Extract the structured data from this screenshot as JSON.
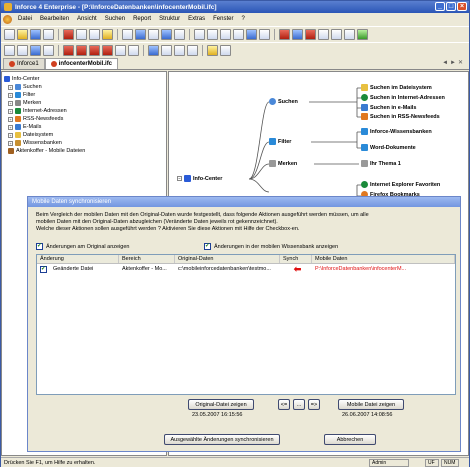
{
  "window": {
    "title": "Inforce 4 Enterprise - [P:\\InforceDatenbanken\\infocenterMobil.ifc]"
  },
  "menu": [
    "Datei",
    "Bearbeiten",
    "Ansicht",
    "Suchen",
    "Report",
    "Struktur",
    "Extras",
    "Fenster",
    "?"
  ],
  "tabs": [
    {
      "label": "Inforce1"
    },
    {
      "label": "infocenterMobil.ifc"
    }
  ],
  "tree": [
    {
      "label": "Info-Center",
      "icon": "info-icon",
      "color": "#2a5bd7",
      "level": 0,
      "pm": ""
    },
    {
      "label": "Suchen",
      "icon": "search-icon",
      "color": "#4a88d8",
      "level": 1,
      "pm": "+"
    },
    {
      "label": "Filter",
      "icon": "filter-icon",
      "color": "#2a8ad8",
      "level": 1,
      "pm": "+"
    },
    {
      "label": "Merken",
      "icon": "pencil-icon",
      "color": "#888888",
      "level": 1,
      "pm": "+"
    },
    {
      "label": "Internet-Adressen",
      "icon": "globe-icon",
      "color": "#1a8a3a",
      "level": 1,
      "pm": "+"
    },
    {
      "label": "RSS-Newsfeeds",
      "icon": "rss-icon",
      "color": "#e07820",
      "level": 1,
      "pm": "+"
    },
    {
      "label": "E-Mails",
      "icon": "mail-icon",
      "color": "#3a7ad0",
      "level": 1,
      "pm": "+"
    },
    {
      "label": "Dateisystem",
      "icon": "folder-icon",
      "color": "#e8c040",
      "level": 1,
      "pm": "+"
    },
    {
      "label": "Wissensbanken",
      "icon": "database-icon",
      "color": "#c89030",
      "level": 1,
      "pm": "+"
    },
    {
      "label": "Aktenkoffer - Mobile Dateien",
      "icon": "briefcase-icon",
      "color": "#a06020",
      "level": 1,
      "pm": ""
    }
  ],
  "map": {
    "root": "Info-Center",
    "suchen": "Suchen",
    "suchen_children": [
      "Suchen im Dateisystem",
      "Suchen in Internet-Adressen",
      "Suchen in e-Mails",
      "Suchen in RSS-Newsfeeds"
    ],
    "filter": "Filter",
    "filter_children": [
      "Inforce-Wissensbanken",
      "Word-Dokumente"
    ],
    "merken": "Merken",
    "merken_children": [
      "Ihr Thema 1"
    ],
    "more_children": [
      "Internet Explorer Favoriten",
      "Firefox Bookmarks"
    ]
  },
  "dialog": {
    "title": "Mobile Daten synchronisieren",
    "text1": "Beim Vergleich der mobilen Daten mit den Original-Daten wurde festgestellt, dass folgende Aktionen ausgeführt werden müssen, um alle",
    "text2": "mobilen Daten mit den Original-Daten abzugleichen (Veränderte Daten jeweils rot gekennzeichnet).",
    "text3": "Welche dieser Aktionen sollen ausgeführt werden ? Aktivieren Sie diese Aktionen mit Hilfe der Checkbox-en.",
    "check1": "Änderungen am Original anzeigen",
    "check2": "Änderungen in der mobilen Wissensbank anzeigen",
    "columns": [
      "Änderung",
      "Bereich",
      "Original-Daten",
      "Synch",
      "Mobile Daten"
    ],
    "row": {
      "aenderung": "Geänderte Datei",
      "bereich": "Aktenkoffer - Mo...",
      "original": "c:\\mobileinforcedatenbanken\\testmo...",
      "mobile": "P:\\InforceDatenbanken\\infocenterM..."
    },
    "btn_original": "Original-Datei zeigen",
    "date_original": "23.05.2007 16:15:56",
    "btn_left": "<=",
    "btn_mid": "...",
    "btn_right": "=>",
    "btn_mobile": "Mobile Datei zeigen",
    "date_mobile": "26.06.2007 14:08:56",
    "btn_sync": "Ausgewählte Änderungen synchronisieren",
    "btn_cancel": "Abbrechen"
  },
  "status": {
    "help": "Drücken Sie F1, um Hilfe zu erhalten.",
    "user": "Admin",
    "mode": "UF",
    "num": "NUM"
  }
}
